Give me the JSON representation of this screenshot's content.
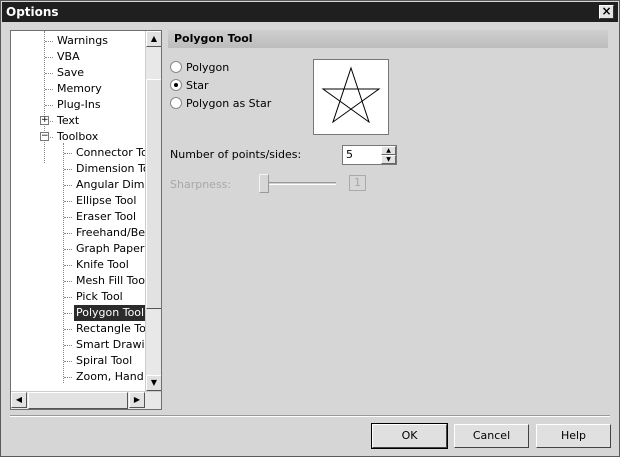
{
  "window": {
    "title": "Options"
  },
  "tree": {
    "items": [
      {
        "label": "Warnings",
        "level": 1
      },
      {
        "label": "VBA",
        "level": 1
      },
      {
        "label": "Save",
        "level": 1
      },
      {
        "label": "Memory",
        "level": 1
      },
      {
        "label": "Plug-Ins",
        "level": 1
      },
      {
        "label": "Text",
        "level": 1,
        "expander": "+"
      },
      {
        "label": "Toolbox",
        "level": 1,
        "expander": "-"
      },
      {
        "label": "Connector Tool",
        "level": 2
      },
      {
        "label": "Dimension Tool",
        "level": 2
      },
      {
        "label": "Angular Dimension",
        "level": 2
      },
      {
        "label": "Ellipse Tool",
        "level": 2
      },
      {
        "label": "Eraser Tool",
        "level": 2
      },
      {
        "label": "Freehand/Bezier",
        "level": 2
      },
      {
        "label": "Graph Paper Tool",
        "level": 2
      },
      {
        "label": "Knife Tool",
        "level": 2
      },
      {
        "label": "Mesh Fill Tool",
        "level": 2
      },
      {
        "label": "Pick Tool",
        "level": 2
      },
      {
        "label": "Polygon Tool",
        "level": 2,
        "selected": true
      },
      {
        "label": "Rectangle Tool",
        "level": 2
      },
      {
        "label": "Smart Drawing",
        "level": 2
      },
      {
        "label": "Spiral Tool",
        "level": 2
      },
      {
        "label": "Zoom, Hand Tool",
        "level": 2
      }
    ],
    "scroll_up_icon": "arrow-up-icon",
    "scroll_down_icon": "arrow-down-icon",
    "scroll_left_icon": "arrow-left-icon",
    "scroll_right_icon": "arrow-right-icon"
  },
  "panel": {
    "header": "Polygon Tool",
    "options": [
      {
        "label": "Polygon",
        "selected": false
      },
      {
        "label": "Star",
        "selected": true
      },
      {
        "label": "Polygon as Star",
        "selected": false
      }
    ],
    "points_label": "Number of points/sides:",
    "points_value": "5",
    "sharpness_label": "Sharpness:",
    "sharpness_value": "1",
    "sharpness_level": 0
  },
  "buttons": {
    "ok": "OK",
    "cancel": "Cancel",
    "help": "Help"
  },
  "icons": {
    "close": "close-icon",
    "preview": "star-preview-icon"
  }
}
